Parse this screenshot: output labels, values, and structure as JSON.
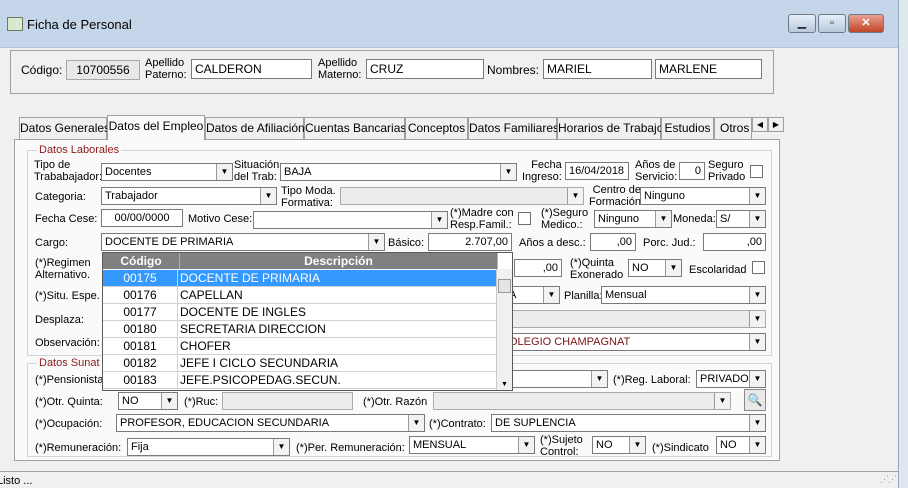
{
  "window": {
    "title": "Ficha de Personal"
  },
  "header": {
    "codigo_label": "Código:",
    "codigo": "10700556",
    "ap_paterno_label": "Apellido\nPaterno:",
    "ap_paterno": "CALDERON",
    "ap_materno_label": "Apellido\nMaterno:",
    "ap_materno": "CRUZ",
    "nombres_label": "Nombres:",
    "nombre1": "MARIEL",
    "nombre2": "MARLENE"
  },
  "tabs": [
    "Datos Generales",
    "Datos del Empleo",
    "Datos de Afiliación",
    "Cuentas Bancarias",
    "Conceptos",
    "Datos Familiares",
    "Horarios de Trabajo",
    "Estudios",
    "Otros D"
  ],
  "laborales": {
    "section": "Datos Laborales",
    "tipo_trab_label": "Tipo de\nTrababajador:",
    "tipo_trab": "Docentes",
    "situacion_label": "Situación\ndel Trab:",
    "situacion": "BAJA",
    "fecha_ingreso_label": "Fecha\nIngreso:",
    "fecha_ingreso": "16/04/2018",
    "anios_servicio_label": "Años de\nServicio:",
    "anios_servicio": "0",
    "seguro_privado_label": "Seguro\nPrivado",
    "categoria_label": "Categoria:",
    "categoria": "Trabajador",
    "tipo_moda_label": "Tipo Moda.\nFormativa:",
    "tipo_moda": "",
    "centro_form_label": "Centro de\nFormación",
    "centro_form": "Ninguno",
    "fecha_cese_label": "Fecha Cese:",
    "fecha_cese": "00/00/0000",
    "motivo_cese_label": "Motivo Cese:",
    "motivo_cese": "",
    "madre_label": "(*)Madre con\nResp.Famil.:",
    "seguro_medico_label": "(*)Seguro\nMedico.:",
    "seguro_medico": "Ninguno",
    "moneda_label": "Moneda:",
    "moneda": "S/",
    "cargo_label": "Cargo:",
    "cargo": "DOCENTE DE PRIMARIA",
    "basico_label": "Básico:",
    "basico": "2.707,00",
    "anios_desc_label": "Años a desc.:",
    "anios_desc": ",00",
    "porc_jud_label": "Porc. Jud.:",
    "porc_jud": ",00",
    "regimen_label": "(*)Regimen\nAlternativo.",
    "regimen_val": ",00",
    "quinta_exon_label": "(*)Quinta\nExonerado",
    "quinta_exon": "NO",
    "escolaridad_label": "Escolaridad",
    "situ_espe_label": "(*)Situ. Espe.",
    "situ_espe": "A",
    "planilla_label": "Planilla:",
    "planilla": "Mensual",
    "desplaza_label": "Desplaza:",
    "observacion_label": "Observación:",
    "observacion": "OLEGIO CHAMPAGNAT"
  },
  "dropdown": {
    "col_codigo": "Código",
    "col_desc": "Descripción",
    "rows": [
      {
        "codigo": "00175",
        "desc": "DOCENTE DE PRIMARIA"
      },
      {
        "codigo": "00176",
        "desc": "CAPELLAN"
      },
      {
        "codigo": "00177",
        "desc": "DOCENTE DE INGLES"
      },
      {
        "codigo": "00180",
        "desc": "SECRETARIA DIRECCION"
      },
      {
        "codigo": "00181",
        "desc": "CHOFER"
      },
      {
        "codigo": "00182",
        "desc": "JEFE I CICLO SECUNDARIA"
      },
      {
        "codigo": "00183",
        "desc": "JEFE.PSICOPEDAG.SECUN."
      }
    ]
  },
  "sunat": {
    "section": "Datos Sunat",
    "pensionista_label": "(*)Pensionista",
    "reg_laboral_label": "(*)Reg. Laboral:",
    "reg_laboral": "PRIVADO",
    "otr_quinta_label": "(*)Otr. Quinta:",
    "otr_quinta": "NO",
    "ruc_label": "(*)Ruc:",
    "ruc": "",
    "otr_razon_label": "(*)Otr. Razón",
    "otr_razon": "",
    "ocupacion_label": "(*)Ocupación:",
    "ocupacion": "PROFESOR, EDUCACION SECUNDARIA",
    "contrato_label": "(*)Contrato:",
    "contrato": "DE SUPLENCIA",
    "remuneracion_label": "(*)Remuneración:",
    "remuneracion": "Fija",
    "per_rem_label": "(*)Per. Remuneración:",
    "per_rem": "MENSUAL",
    "sujeto_control_label": "(*)Sujeto\nControl:",
    "sujeto_control": "NO",
    "sindicato_label": "(*)Sindicato",
    "sindicato": "NO"
  },
  "status": {
    "text": "Listo ..."
  }
}
